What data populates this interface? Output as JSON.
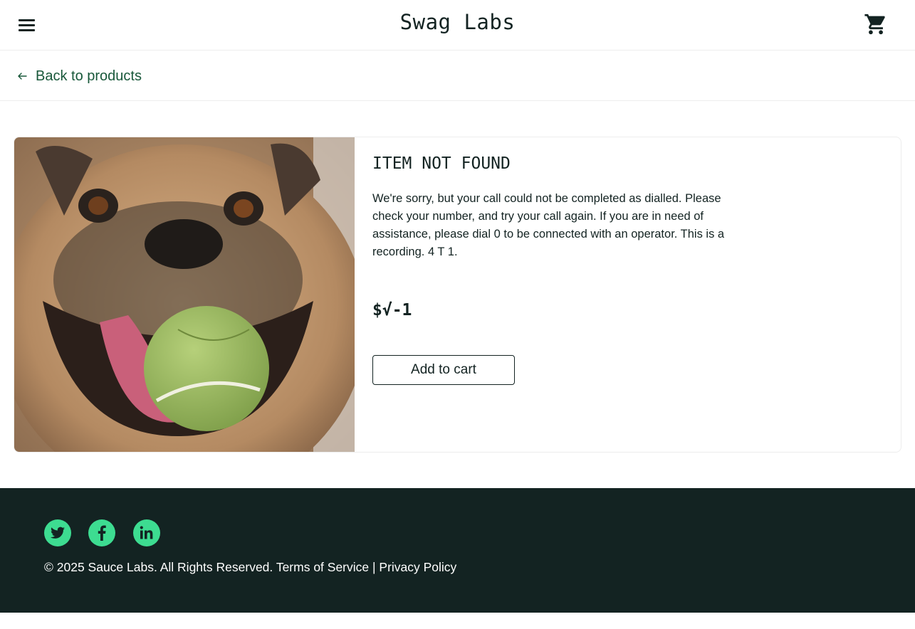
{
  "header": {
    "logo": "Swag Labs",
    "menu_icon": "hamburger-menu-icon",
    "cart_icon": "shopping-cart-icon"
  },
  "subheader": {
    "back_label": "Back to products",
    "back_icon": "arrow-left-icon"
  },
  "item": {
    "name": "ITEM NOT FOUND",
    "description": "We're sorry, but your call could not be completed as dialled. Please check your number, and try your call again. If you are in need of assistance, please dial 0 to be connected with an operator. This is a recording. 4 T 1.",
    "price": "$√-1",
    "add_to_cart": "Add to cart"
  },
  "footer": {
    "social": [
      "twitter-icon",
      "facebook-icon",
      "linkedin-icon"
    ],
    "copyright": "© 2025 Sauce Labs. All Rights Reserved. Terms of Service | Privacy Policy"
  },
  "colors": {
    "brand_dark": "#132322",
    "link_green": "#18583a",
    "social_green": "#3ddc91"
  }
}
